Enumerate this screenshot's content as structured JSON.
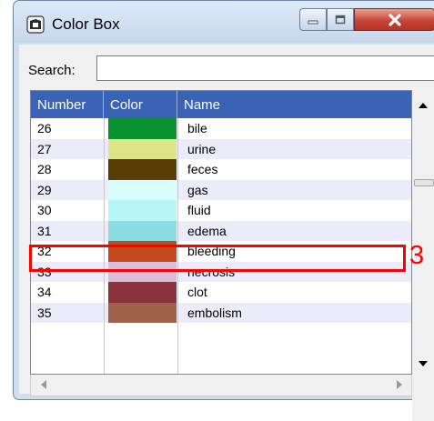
{
  "window": {
    "title": "Color Box"
  },
  "search": {
    "label": "Search:",
    "value": ""
  },
  "table": {
    "columns": [
      "Number",
      "Color",
      "Name"
    ],
    "rows": [
      {
        "number": "26",
        "color": "#0a9130",
        "name": "bile"
      },
      {
        "number": "27",
        "color": "#dfe587",
        "name": "urine"
      },
      {
        "number": "28",
        "color": "#5a3c05",
        "name": "feces"
      },
      {
        "number": "29",
        "color": "#d9fdfd",
        "name": "gas"
      },
      {
        "number": "30",
        "color": "#b5f7f7",
        "name": "fluid"
      },
      {
        "number": "31",
        "color": "#89dde1",
        "name": "edema"
      },
      {
        "number": "32",
        "color": "#c64a1f",
        "name": "bleeding"
      },
      {
        "number": "33",
        "color": "#d8bed9",
        "name": "necrosis"
      },
      {
        "number": "34",
        "color": "#8a323d",
        "name": "clot"
      },
      {
        "number": "35",
        "color": "#9e6249",
        "name": "embolism"
      }
    ]
  },
  "annotation": {
    "label": "3",
    "highlighted_row": "31",
    "color": "#ff0000"
  },
  "colors": {
    "header": "#3a63b6",
    "row_alt": "#ebebf9"
  }
}
